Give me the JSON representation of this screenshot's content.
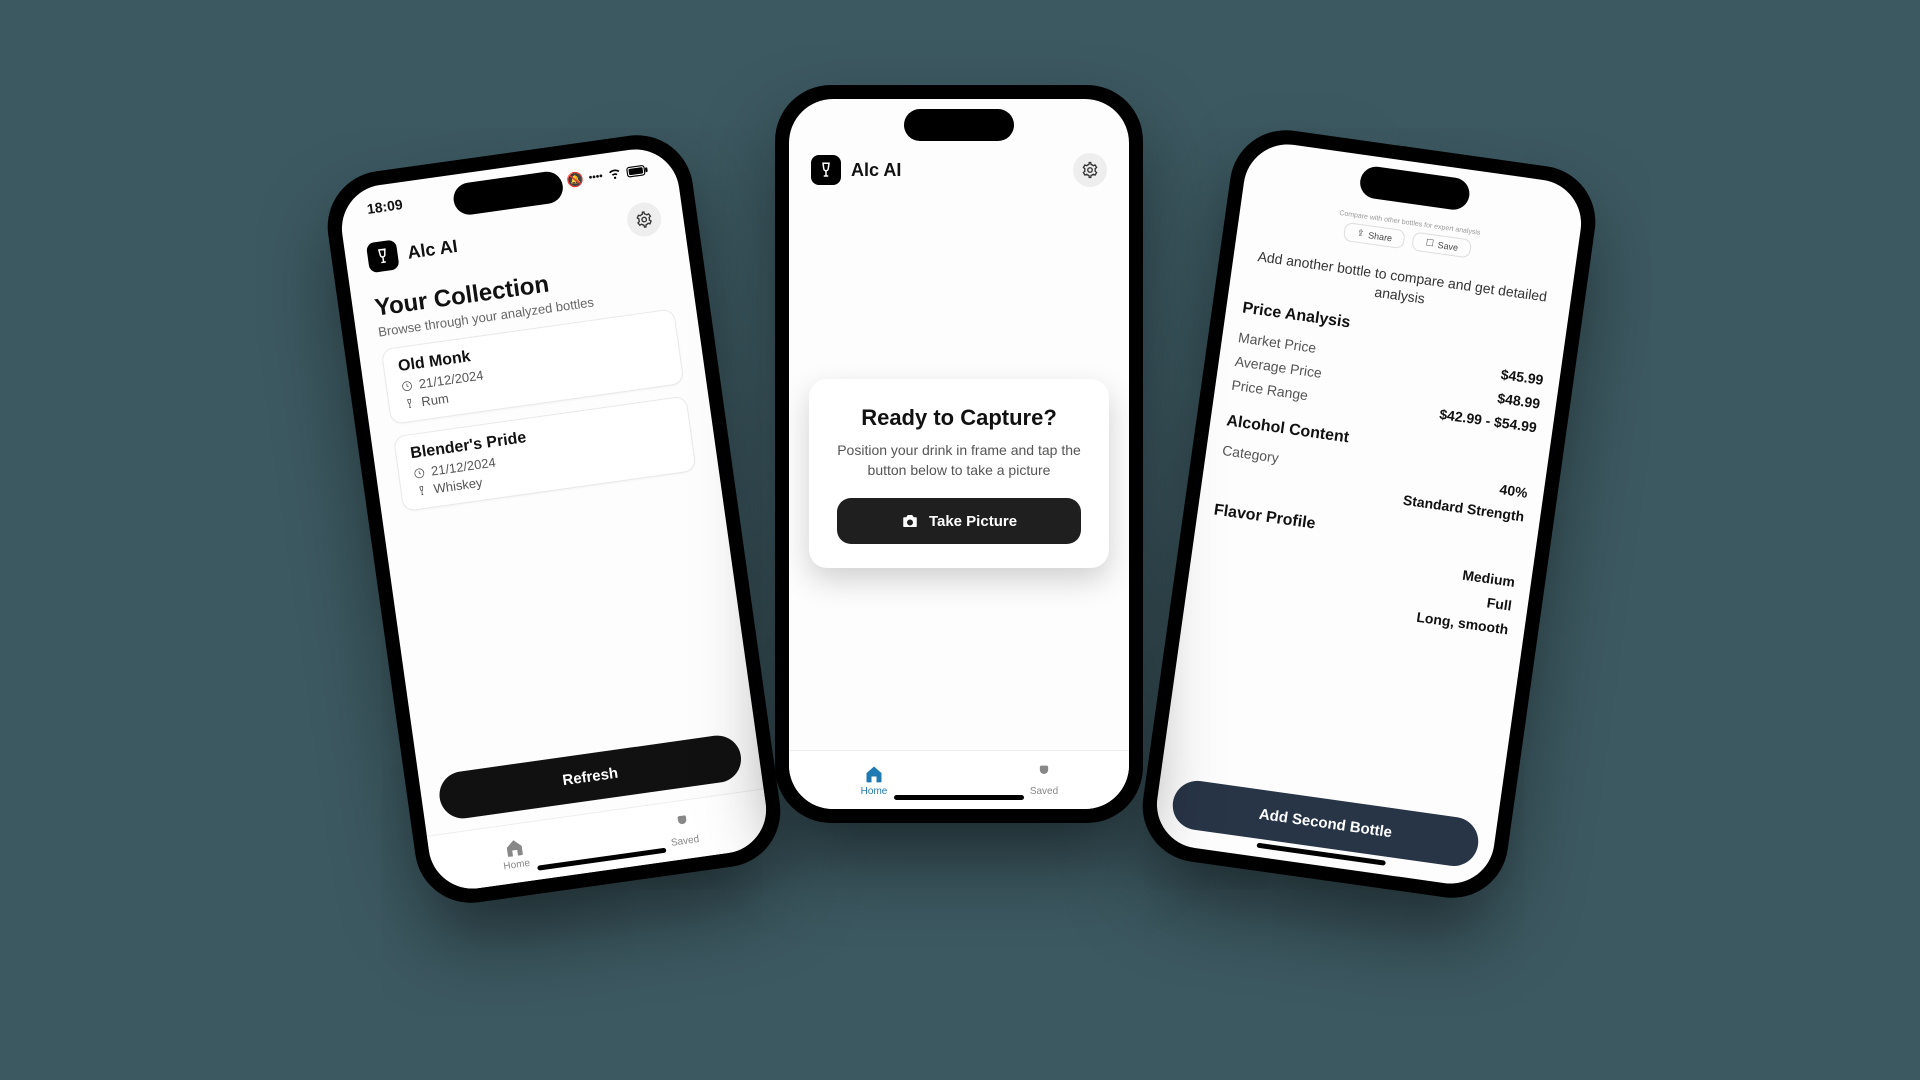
{
  "app": {
    "name": "Alc AI"
  },
  "status": {
    "time": "18:09"
  },
  "left": {
    "title": "Your Collection",
    "subtitle": "Browse through your analyzed bottles",
    "items": [
      {
        "name": "Old Monk",
        "date": "21/12/2024",
        "type": "Rum"
      },
      {
        "name": "Blender's Pride",
        "date": "21/12/2024",
        "type": "Whiskey"
      }
    ],
    "refresh": "Refresh",
    "nav": {
      "home": "Home",
      "saved": "Saved"
    }
  },
  "mid": {
    "heading": "Ready to Capture?",
    "body": "Position your drink in frame and tap the button below to take a picture",
    "cta": "Take Picture",
    "nav": {
      "home": "Home",
      "saved": "Saved"
    }
  },
  "right": {
    "headerTiny": "Compare with other bottles for expert analysis",
    "share": "Share",
    "save": "Save",
    "addLine": "Add another bottle to compare and get detailed analysis",
    "priceTitle": "Price Analysis",
    "rows": {
      "market": {
        "k": "Market Price",
        "v": "$45.99"
      },
      "avg": {
        "k": "Average Price",
        "v": "$48.99"
      },
      "range": {
        "k": "Price Range",
        "v": "$42.99 - $54.99"
      }
    },
    "alcTitle": "Alcohol Content",
    "alc": {
      "cat": {
        "k": "Category",
        "v": "40%"
      },
      "str": {
        "v": "Standard Strength"
      }
    },
    "flavorTitle": "Flavor Profile",
    "flavor": {
      "a": {
        "v": "Medium"
      },
      "b": {
        "v": "Full"
      },
      "c": {
        "v": "Long, smooth"
      }
    },
    "cta": "Add Second Bottle"
  }
}
